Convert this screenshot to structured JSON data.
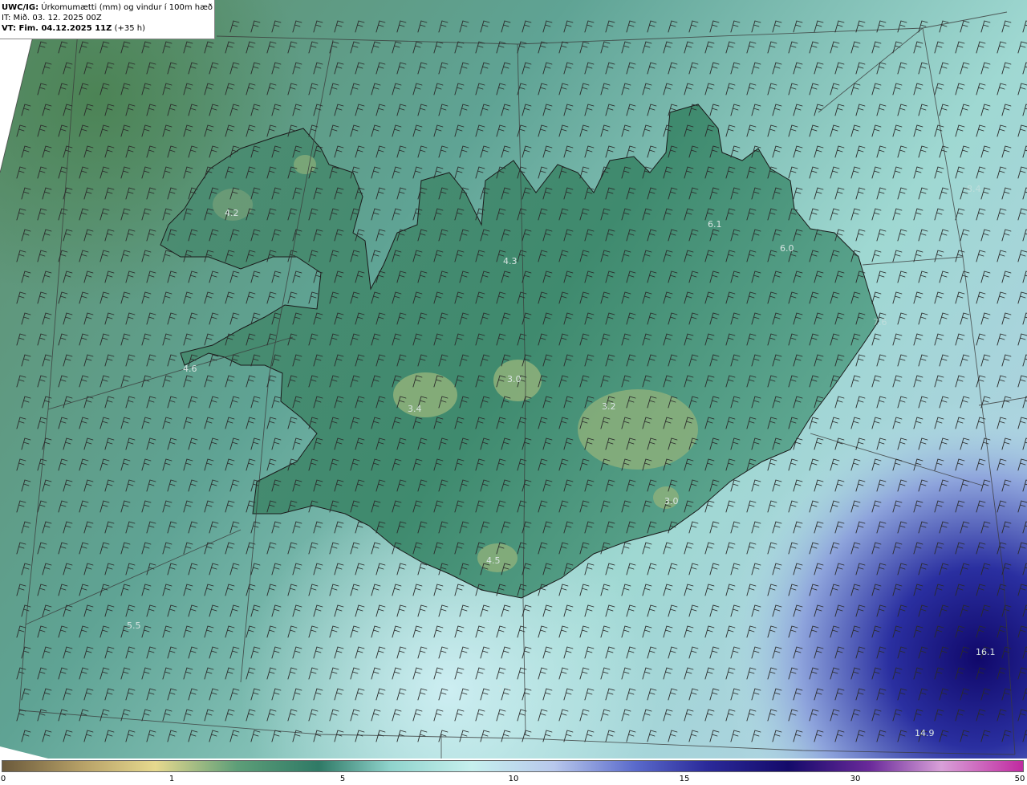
{
  "header": {
    "model_code": "UWC/IG:",
    "title": "Úrkomumætti (mm) og vindur í 100m hæð",
    "issue_time": "IT: Mið. 03. 12. 2025 00Z",
    "valid_prefix": "VT: Fim. 04.12.2025 11Z",
    "valid_suffix": "(+35 h)"
  },
  "colorbar": {
    "ticks": [
      "0",
      "1",
      "5",
      "10",
      "15",
      "30",
      "50"
    ],
    "colors": [
      "#6b5a3c",
      "#b8a268",
      "#e6d98e",
      "#5d9e78",
      "#2f7a66",
      "#8fd3cc",
      "#c6f0ee",
      "#b8c8ec",
      "#5a6acb",
      "#2b2a9a",
      "#140a6a",
      "#6a2a9a",
      "#d8a0d8",
      "#c02aa0"
    ]
  },
  "map_labels": [
    {
      "text": "4.2"
    },
    {
      "text": "4.3"
    },
    {
      "text": "6.1"
    },
    {
      "text": "6.0"
    },
    {
      "text": "4.6"
    },
    {
      "text": "3.4"
    },
    {
      "text": "3.0"
    },
    {
      "text": "3.2"
    },
    {
      "text": "3.0"
    },
    {
      "text": "4.5"
    },
    {
      "text": "5.5"
    },
    {
      "text": "16.1"
    },
    {
      "text": "14.9"
    },
    {
      "text": "8.4"
    },
    {
      "text": "7.6"
    },
    {
      "text": "7.7"
    }
  ]
}
